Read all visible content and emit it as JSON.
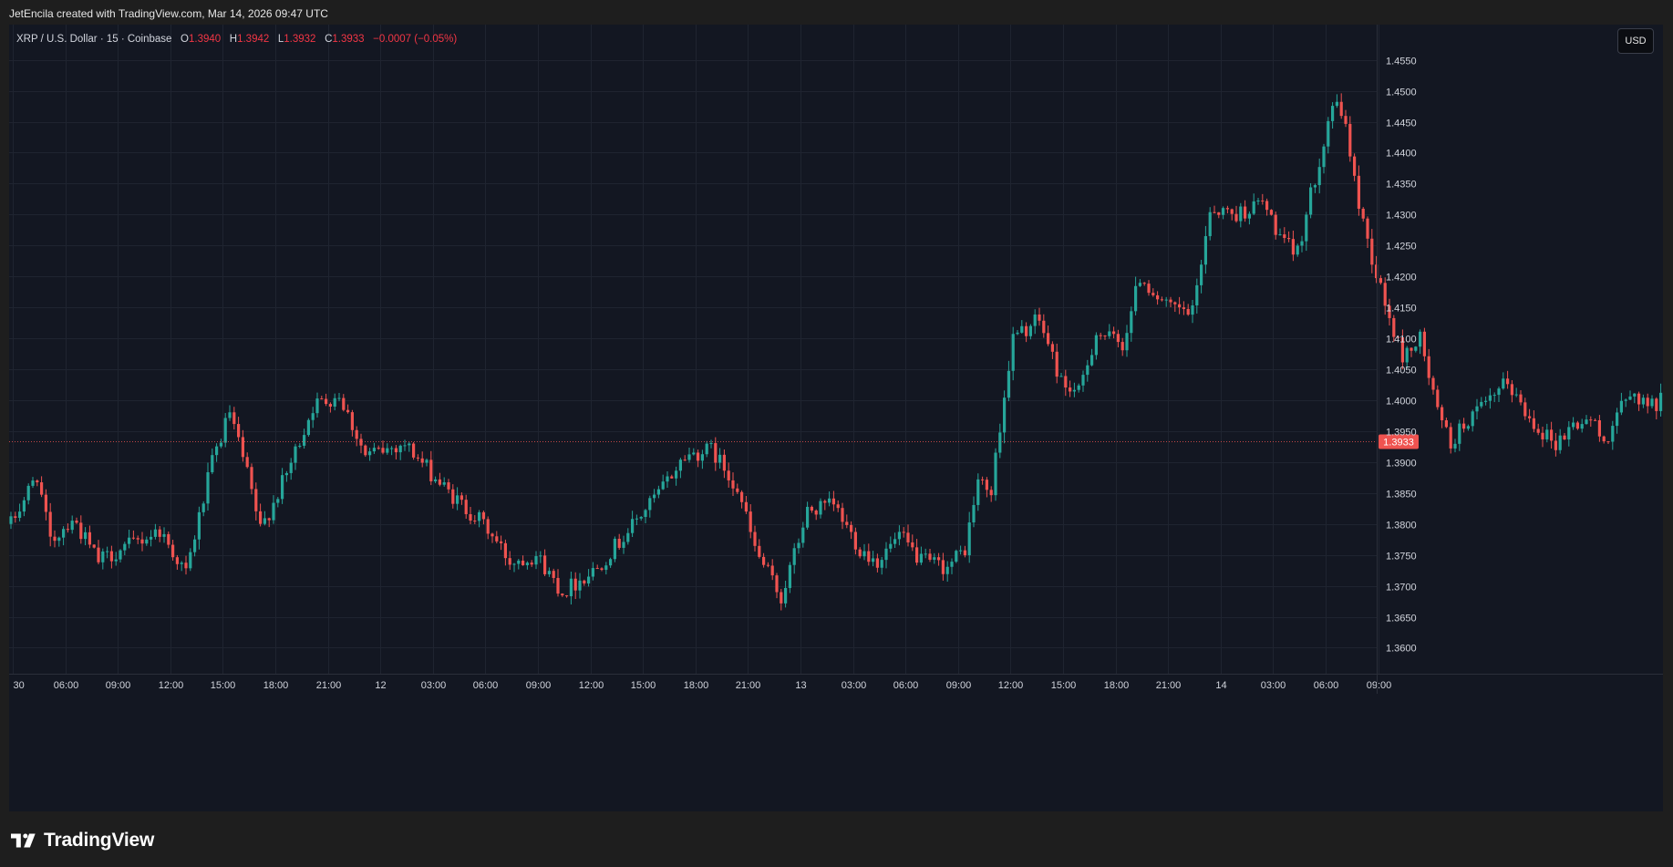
{
  "credit": "JetEncila created with TradingView.com, Mar 14, 2026 09:47 UTC",
  "legend": {
    "symbol": "XRP / U.S. Dollar · 15 · Coinbase",
    "o_label": "O",
    "o_value": "1.3940",
    "h_label": "H",
    "h_value": "1.3942",
    "l_label": "L",
    "l_value": "1.3932",
    "c_label": "C",
    "c_value": "1.3933",
    "change": "−0.0007 (−0.05%)"
  },
  "currency_button": "USD",
  "brand": "TradingView",
  "colors": {
    "up": "#26a69a",
    "down": "#ef5350",
    "background": "#131722",
    "grid": "#1f2430",
    "axis_text": "#d1d4dc",
    "price_line": "#ef5350"
  },
  "chart_data": {
    "type": "candlestick",
    "interval_minutes": 15,
    "ylim": [
      1.3558,
      1.4607
    ],
    "y_ticks": [
      "1.3600",
      "1.3650",
      "1.3700",
      "1.3750",
      "1.3800",
      "1.3850",
      "1.3900",
      "1.3950",
      "1.4000",
      "1.4050",
      "1.4100",
      "1.4150",
      "1.4200",
      "1.4250",
      "1.4300",
      "1.4350",
      "1.4400",
      "1.4450",
      "1.4500",
      "1.4550"
    ],
    "x_ticks": [
      "30",
      "06:00",
      "09:00",
      "12:00",
      "15:00",
      "18:00",
      "21:00",
      "12",
      "03:00",
      "06:00",
      "09:00",
      "12:00",
      "15:00",
      "18:00",
      "21:00",
      "13",
      "03:00",
      "06:00",
      "09:00",
      "12:00",
      "15:00",
      "18:00",
      "21:00",
      "14",
      "03:00",
      "06:00",
      "09:00"
    ],
    "last_price": "1.3933",
    "anchors": [
      {
        "t": 0,
        "p": 1.38
      },
      {
        "t": 6,
        "p": 1.388
      },
      {
        "t": 9,
        "p": 1.377
      },
      {
        "t": 14,
        "p": 1.381
      },
      {
        "t": 20,
        "p": 1.374
      },
      {
        "t": 34,
        "p": 1.379
      },
      {
        "t": 40,
        "p": 1.372
      },
      {
        "t": 46,
        "p": 1.39
      },
      {
        "t": 50,
        "p": 1.398
      },
      {
        "t": 54,
        "p": 1.388
      },
      {
        "t": 57,
        "p": 1.379
      },
      {
        "t": 63,
        "p": 1.388
      },
      {
        "t": 69,
        "p": 1.399
      },
      {
        "t": 75,
        "p": 1.401
      },
      {
        "t": 81,
        "p": 1.391
      },
      {
        "t": 90,
        "p": 1.393
      },
      {
        "t": 100,
        "p": 1.385
      },
      {
        "t": 108,
        "p": 1.38
      },
      {
        "t": 114,
        "p": 1.374
      },
      {
        "t": 120,
        "p": 1.375
      },
      {
        "t": 126,
        "p": 1.369
      },
      {
        "t": 134,
        "p": 1.373
      },
      {
        "t": 140,
        "p": 1.378
      },
      {
        "t": 148,
        "p": 1.385
      },
      {
        "t": 154,
        "p": 1.391
      },
      {
        "t": 160,
        "p": 1.392
      },
      {
        "t": 166,
        "p": 1.386
      },
      {
        "t": 170,
        "p": 1.376
      },
      {
        "t": 176,
        "p": 1.368
      },
      {
        "t": 182,
        "p": 1.382
      },
      {
        "t": 188,
        "p": 1.383
      },
      {
        "t": 194,
        "p": 1.376
      },
      {
        "t": 198,
        "p": 1.374
      },
      {
        "t": 203,
        "p": 1.378
      },
      {
        "t": 208,
        "p": 1.374
      },
      {
        "t": 214,
        "p": 1.373
      },
      {
        "t": 218,
        "p": 1.376
      },
      {
        "t": 221,
        "p": 1.387
      },
      {
        "t": 224,
        "p": 1.385
      },
      {
        "t": 226,
        "p": 1.396
      },
      {
        "t": 229,
        "p": 1.41
      },
      {
        "t": 235,
        "p": 1.413
      },
      {
        "t": 240,
        "p": 1.403
      },
      {
        "t": 244,
        "p": 1.401
      },
      {
        "t": 248,
        "p": 1.411
      },
      {
        "t": 254,
        "p": 1.409
      },
      {
        "t": 258,
        "p": 1.42
      },
      {
        "t": 264,
        "p": 1.415
      },
      {
        "t": 270,
        "p": 1.414
      },
      {
        "t": 274,
        "p": 1.431
      },
      {
        "t": 280,
        "p": 1.43
      },
      {
        "t": 286,
        "p": 1.432
      },
      {
        "t": 291,
        "p": 1.425
      },
      {
        "t": 294,
        "p": 1.424
      },
      {
        "t": 298,
        "p": 1.436
      },
      {
        "t": 302,
        "p": 1.448
      },
      {
        "t": 305,
        "p": 1.445
      },
      {
        "t": 307,
        "p": 1.435
      },
      {
        "t": 311,
        "p": 1.423
      },
      {
        "t": 315,
        "p": 1.413
      },
      {
        "t": 318,
        "p": 1.407
      },
      {
        "t": 322,
        "p": 1.41
      },
      {
        "t": 326,
        "p": 1.398
      },
      {
        "t": 329,
        "p": 1.393
      },
      {
        "t": 333,
        "p": 1.397
      },
      {
        "t": 337,
        "p": 1.399
      },
      {
        "t": 342,
        "p": 1.403
      },
      {
        "t": 346,
        "p": 1.398
      },
      {
        "t": 350,
        "p": 1.395
      },
      {
        "t": 353,
        "p": 1.393
      },
      {
        "t": 357,
        "p": 1.396
      },
      {
        "t": 361,
        "p": 1.397
      },
      {
        "t": 364,
        "p": 1.393
      },
      {
        "t": 367,
        "p": 1.398
      },
      {
        "t": 371,
        "p": 1.401
      },
      {
        "t": 375,
        "p": 1.399
      },
      {
        "t": 379,
        "p": 1.401
      },
      {
        "t": 383,
        "p": 1.4
      },
      {
        "t": 387,
        "p": 1.397
      },
      {
        "t": 390,
        "p": 1.394
      },
      {
        "t": 393,
        "p": 1.389
      },
      {
        "t": 396,
        "p": 1.393
      },
      {
        "t": 400,
        "p": 1.396
      },
      {
        "t": 404,
        "p": 1.394
      },
      {
        "t": 406,
        "p": 1.3933
      }
    ]
  }
}
